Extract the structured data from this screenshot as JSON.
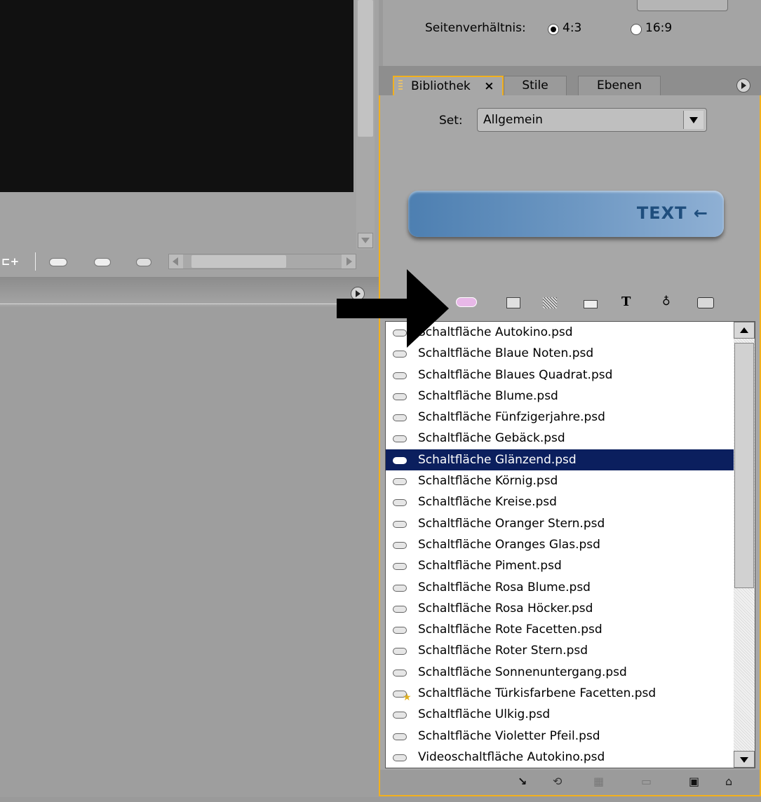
{
  "aspect_ratio": {
    "label": "Seitenverhältnis:",
    "options": [
      {
        "label": "4:3",
        "selected": true
      },
      {
        "label": "16:9",
        "selected": false
      }
    ]
  },
  "library_tabs": [
    {
      "label": "Bibliothek",
      "active": true,
      "close_glyph": "×"
    },
    {
      "label": "Stile",
      "active": false
    },
    {
      "label": "Ebenen",
      "active": false
    }
  ],
  "set": {
    "label": "Set:",
    "value": "Allgemein"
  },
  "preview_text": "TEXT ←",
  "filter_icons": [
    "button-icon",
    "image-icon",
    "texture-icon",
    "folder-icon",
    "text-icon",
    "fill-icon",
    "import-icon"
  ],
  "items": [
    {
      "name": "Schaltfläche Autokino.psd",
      "selected": false,
      "favorite": false
    },
    {
      "name": "Schaltfläche Blaue Noten.psd",
      "selected": false,
      "favorite": false
    },
    {
      "name": "Schaltfläche Blaues Quadrat.psd",
      "selected": false,
      "favorite": false
    },
    {
      "name": "Schaltfläche Blume.psd",
      "selected": false,
      "favorite": false
    },
    {
      "name": "Schaltfläche Fünfzigerjahre.psd",
      "selected": false,
      "favorite": false
    },
    {
      "name": "Schaltfläche Gebäck.psd",
      "selected": false,
      "favorite": false
    },
    {
      "name": "Schaltfläche Glänzend.psd",
      "selected": true,
      "favorite": false
    },
    {
      "name": "Schaltfläche Körnig.psd",
      "selected": false,
      "favorite": false
    },
    {
      "name": "Schaltfläche Kreise.psd",
      "selected": false,
      "favorite": false
    },
    {
      "name": "Schaltfläche Oranger Stern.psd",
      "selected": false,
      "favorite": false
    },
    {
      "name": "Schaltfläche Oranges Glas.psd",
      "selected": false,
      "favorite": false
    },
    {
      "name": "Schaltfläche Piment.psd",
      "selected": false,
      "favorite": false
    },
    {
      "name": "Schaltfläche Rosa Blume.psd",
      "selected": false,
      "favorite": false
    },
    {
      "name": "Schaltfläche Rosa Höcker.psd",
      "selected": false,
      "favorite": false
    },
    {
      "name": "Schaltfläche Rote Facetten.psd",
      "selected": false,
      "favorite": false
    },
    {
      "name": "Schaltfläche Roter Stern.psd",
      "selected": false,
      "favorite": false
    },
    {
      "name": "Schaltfläche Sonnenuntergang.psd",
      "selected": false,
      "favorite": false
    },
    {
      "name": "Schaltfläche Türkisfarbene Facetten.psd",
      "selected": false,
      "favorite": true
    },
    {
      "name": "Schaltfläche Ulkig.psd",
      "selected": false,
      "favorite": false
    },
    {
      "name": "Schaltfläche Violetter Pfeil.psd",
      "selected": false,
      "favorite": false
    },
    {
      "name": "Videoschaltfläche Autokino.psd",
      "selected": false,
      "favorite": false
    }
  ],
  "bottom_icons": [
    "apply-arrow-icon",
    "replace-icon",
    "new-texture-icon",
    "new-item-icon",
    "new-file-icon",
    "trash-icon"
  ],
  "colors": {
    "panel_border": "#f2b01e",
    "selection": "#0b1f5e",
    "preview_button": "#5f8dbd",
    "preview_text": "#1f4e7d"
  }
}
